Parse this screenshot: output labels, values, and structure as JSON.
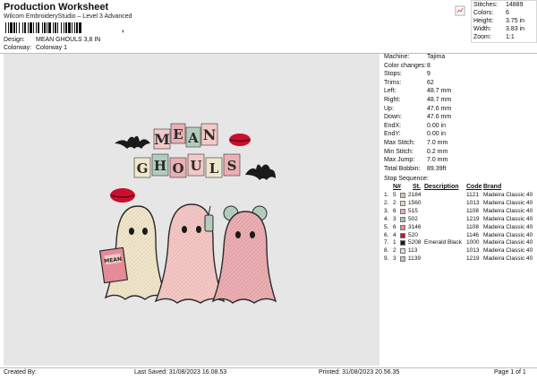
{
  "header": {
    "title": "Production Worksheet",
    "subtitle": "Wilcom EmbroideryStudio – Level 3 Advanced",
    "barcode_suffix": ","
  },
  "meta": {
    "design_label": "Design:",
    "design_value": "MEAN GHOULS 3,8 IN",
    "colorway_label": "Colorway:",
    "colorway_value": "Colorway 1"
  },
  "stats": {
    "stitches_label": "Stitches:",
    "stitches_value": "14889",
    "colors_label": "Colors:",
    "colors_value": "6",
    "height_label": "Height:",
    "height_value": "3.75 in",
    "width_label": "Width:",
    "width_value": "3.83 in",
    "zoom_label": "Zoom:",
    "zoom_value": "1:1"
  },
  "design": {
    "letters": [
      "M",
      "E",
      "A",
      "N",
      "G",
      "H",
      "O",
      "U",
      "L",
      "S"
    ],
    "book_text": "MEAN"
  },
  "machine_info": [
    {
      "label": "Machine:",
      "value": "Tajima"
    },
    {
      "label": "Color changes:",
      "value": "8"
    },
    {
      "label": "Stops:",
      "value": "9"
    },
    {
      "label": "Trims:",
      "value": "62"
    },
    {
      "label": "Left:",
      "value": "48.7 mm"
    },
    {
      "label": "Right:",
      "value": "48.7 mm"
    },
    {
      "label": "Up:",
      "value": "47.6 mm"
    },
    {
      "label": "Down:",
      "value": "47.6 mm"
    },
    {
      "label": "EndX:",
      "value": "0.00 in"
    },
    {
      "label": "EndY:",
      "value": "0.00 in"
    },
    {
      "label": "Max Stitch:",
      "value": "7.0 mm"
    },
    {
      "label": "Min Stitch:",
      "value": "0.2 mm"
    },
    {
      "label": "Max Jump:",
      "value": "7.0 mm"
    },
    {
      "label": "Total Bobbin:",
      "value": "89.39ft"
    }
  ],
  "stop_sequence": {
    "title": "Stop Sequence:",
    "headers": {
      "no": "N#",
      "st": "St.",
      "desc": "Description",
      "code": "Code",
      "brand": "Brand"
    },
    "rows": [
      {
        "idx": "1.",
        "n": "5",
        "color": "#e8b7b0",
        "thread": "2184",
        "desc": "",
        "code": "1121",
        "brand": "Madeira Classic 40"
      },
      {
        "idx": "2.",
        "n": "2",
        "color": "#f0d2c4",
        "thread": "1560",
        "desc": "",
        "code": "1013",
        "brand": "Madeira Classic 40"
      },
      {
        "idx": "3.",
        "n": "6",
        "color": "#f2a5b3",
        "thread": "515",
        "desc": "",
        "code": "1108",
        "brand": "Madeira Classic 40"
      },
      {
        "idx": "4.",
        "n": "3",
        "color": "#a9c1b3",
        "thread": "502",
        "desc": "",
        "code": "1219",
        "brand": "Madeira Classic 40"
      },
      {
        "idx": "5.",
        "n": "6",
        "color": "#e58b97",
        "thread": "3146",
        "desc": "",
        "code": "1108",
        "brand": "Madeira Classic 40"
      },
      {
        "idx": "6.",
        "n": "4",
        "color": "#c8102e",
        "thread": "520",
        "desc": "",
        "code": "1146",
        "brand": "Madeira Classic 40"
      },
      {
        "idx": "7.",
        "n": "1",
        "color": "#1a1a1a",
        "thread": "5208",
        "desc": "Emerald Black",
        "code": "1000",
        "brand": "Madeira Classic 40"
      },
      {
        "idx": "8.",
        "n": "2",
        "color": "#f3d5cf",
        "thread": "113",
        "desc": "",
        "code": "1013",
        "brand": "Madeira Classic 40"
      },
      {
        "idx": "9.",
        "n": "3",
        "color": "#b3cbbd",
        "thread": "1139",
        "desc": "",
        "code": "1219",
        "brand": "Madeira Classic 40"
      }
    ]
  },
  "footer": {
    "created_by": "Created By:",
    "last_saved": "Last Saved: 31/08/2023 16.08.53",
    "printed": "Printed: 31/08/2023 20.56.35",
    "page": "Page 1 of 1"
  }
}
